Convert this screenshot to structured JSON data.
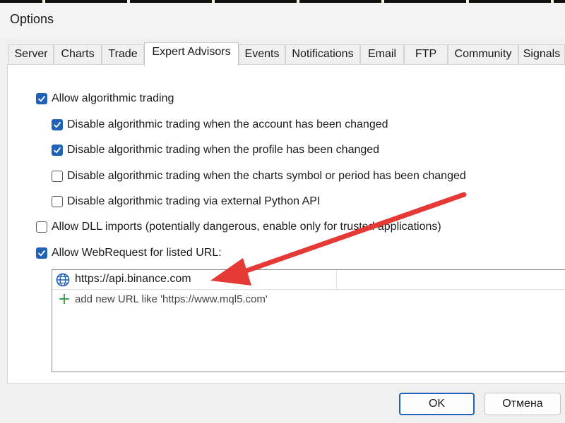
{
  "window": {
    "title": "Options"
  },
  "tabs": [
    {
      "label": "Server"
    },
    {
      "label": "Charts"
    },
    {
      "label": "Trade"
    },
    {
      "label": "Expert Advisors"
    },
    {
      "label": "Events"
    },
    {
      "label": "Notifications"
    },
    {
      "label": "Email"
    },
    {
      "label": "FTP"
    },
    {
      "label": "Community"
    },
    {
      "label": "Signals"
    }
  ],
  "active_tab": "Expert Advisors",
  "options": [
    {
      "label": "Allow algorithmic trading",
      "checked": true
    },
    {
      "label": "Disable algorithmic trading when the account has been changed",
      "checked": true
    },
    {
      "label": "Disable algorithmic trading when the profile has been changed",
      "checked": true
    },
    {
      "label": "Disable algorithmic trading when the charts symbol or period has been changed",
      "checked": false
    },
    {
      "label": "Disable algorithmic trading via external Python API",
      "checked": false
    },
    {
      "label": "Allow DLL imports (potentially dangerous, enable only for trusted applications)",
      "checked": false
    },
    {
      "label": "Allow WebRequest for listed URL:",
      "checked": true
    }
  ],
  "url_list": {
    "urls": [
      "https://api.binance.com"
    ],
    "add_placeholder": "add new URL like 'https://www.mql5.com'"
  },
  "buttons": {
    "ok": "OK",
    "cancel": "Отмена"
  },
  "colors": {
    "accent": "#1f62b8",
    "annotation_arrow": "#e53935",
    "add_icon": "#2e9e3e"
  },
  "icons": {
    "url_item": "globe-icon",
    "add_item": "plus-icon",
    "annotation": "arrow-annotation"
  }
}
